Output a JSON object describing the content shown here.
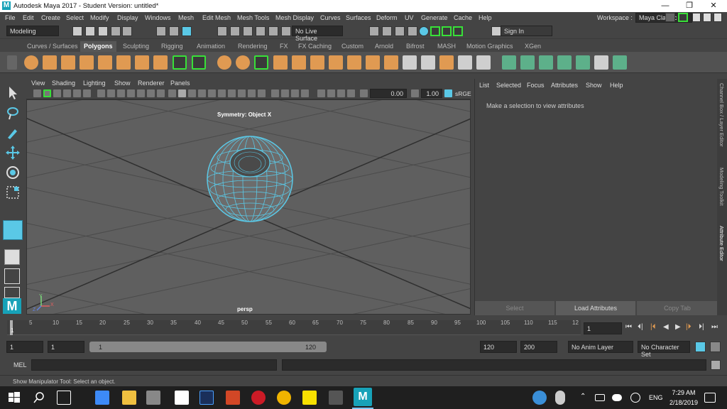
{
  "window": {
    "title": "Autodesk Maya 2017 - Student Version: untitled*",
    "logo": "M",
    "minimize": "—",
    "restore": "❐",
    "close": "✕"
  },
  "menus": [
    "File",
    "Edit",
    "Create",
    "Select",
    "Modify",
    "Display",
    "Windows",
    "Mesh",
    "Edit Mesh",
    "Mesh Tools",
    "Mesh Display",
    "Curves",
    "Surfaces",
    "Deform",
    "UV",
    "Generate",
    "Cache",
    "Help"
  ],
  "workspace": {
    "label": "Workspace :",
    "value": "Maya Classic"
  },
  "status": {
    "menu_set": "Modeling",
    "live_surface": "No Live Surface",
    "sign_in": "Sign In"
  },
  "shelf_tabs": [
    "Curves / Surfaces",
    "Polygons",
    "Sculpting",
    "Rigging",
    "Animation",
    "Rendering",
    "FX",
    "FX Caching",
    "Custom",
    "Arnold",
    "Bifrost",
    "MASH",
    "Motion Graphics",
    "XGen"
  ],
  "panel_menu": [
    "View",
    "Shading",
    "Lighting",
    "Show",
    "Renderer",
    "Panels"
  ],
  "panel_tools": {
    "exposure": "0.00",
    "gamma": "1.00",
    "colorspace": "sRGE"
  },
  "viewport": {
    "symmetry": "Symmetry: Object X",
    "camera": "persp",
    "axis_y": "Y",
    "axis_x": "X",
    "axis_z": "Z"
  },
  "attribute_editor": {
    "menu": [
      "List",
      "Selected",
      "Focus",
      "Attributes",
      "Show",
      "Help"
    ],
    "message": "Make a selection to view attributes",
    "buttons": [
      "Select",
      "Load Attributes",
      "Copy Tab"
    ]
  },
  "side_tabs": [
    "Channel Box / Layer Editor",
    "Modeling Toolkit",
    "Attribute Editor"
  ],
  "timeline": {
    "ticks": [
      "1",
      "5",
      "10",
      "15",
      "20",
      "25",
      "30",
      "35",
      "40",
      "45",
      "50",
      "55",
      "60",
      "65",
      "70",
      "75",
      "80",
      "85",
      "90",
      "95",
      "100",
      "105",
      "110",
      "115",
      "12"
    ],
    "current_frame": "1",
    "playback": [
      "⏮",
      "⏴|",
      "|⏴",
      "◀",
      "▶",
      "|⏵",
      "⏵|",
      "⏭"
    ]
  },
  "range": {
    "start": "1",
    "playback_start": "1",
    "slider_start": "1",
    "slider_end": "120",
    "playback_end": "120",
    "end": "200",
    "anim_layer": "No Anim Layer",
    "character_set": "No Character Set"
  },
  "command_line": {
    "label": "MEL"
  },
  "help_line": "Show Manipulator Tool: Select an object.",
  "taskbar": {
    "time": "7:29 AM",
    "date": "2/18/2019",
    "lang": "ENG"
  },
  "colors": {
    "accent": "#5ac8e6",
    "shelf_orange": "#e09a52",
    "highlight_green": "#38e038"
  }
}
